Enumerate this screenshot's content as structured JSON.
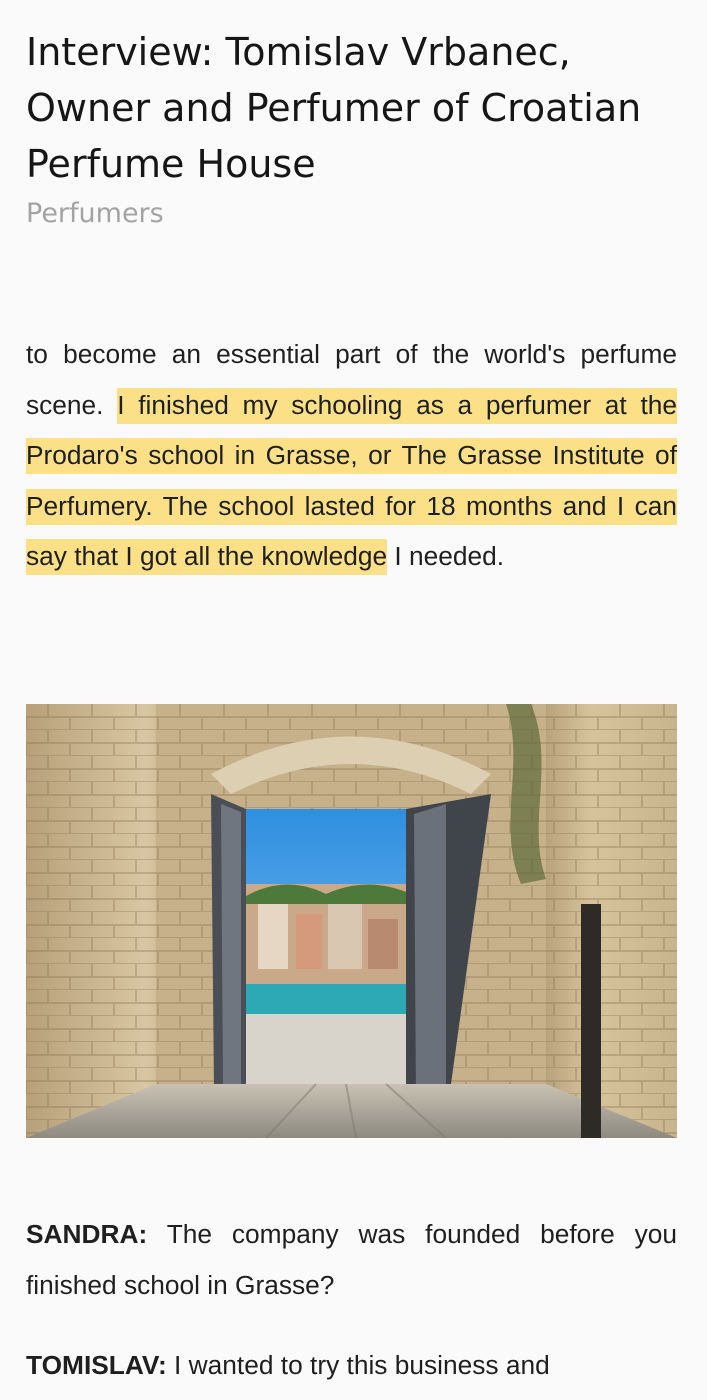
{
  "article": {
    "title": "Interview: Tomislav Vrbanec, Owner and Perfumer of Croatian Perfume House",
    "category": "Perfumers",
    "intro": {
      "before_highlight": "to become an essential part of the world's perfume scene. ",
      "highlight": "I finished my schooling as a perfumer at the Prodaro's school in Grasse, or The Grasse Institute of Perfumery. The school lasted for 18 months and I can say that I got all the knowledge",
      "after_highlight": " I needed."
    },
    "qa": [
      {
        "speaker": "SANDRA:",
        "text": " The company was founded before you finished school in Grasse?"
      },
      {
        "speaker": "TOMISLAV:",
        "text": " I wanted to try this business and"
      }
    ]
  },
  "colors": {
    "highlight": "#fbe088",
    "category_text": "#a3a3a3",
    "background": "#fafafa"
  }
}
